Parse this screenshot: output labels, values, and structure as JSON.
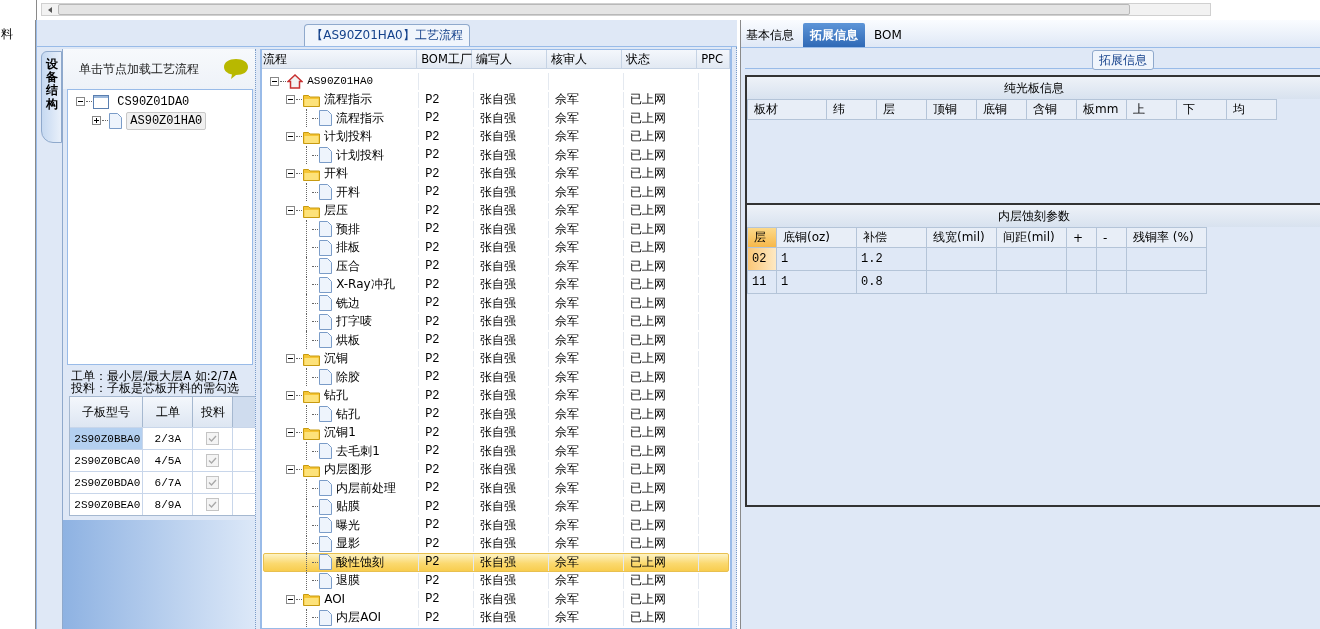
{
  "left_edge": {
    "label": "料"
  },
  "process_panel": {
    "title": "【AS90Z01HA0】工艺流程",
    "side_tab": "设备结构",
    "hint": "单击节点加载工艺流程",
    "device_tree": [
      {
        "name": "CS90Z01DA0",
        "expanded": true,
        "selected": false,
        "children": [
          {
            "name": "AS90Z01HA0",
            "expanded": false,
            "selected": true
          }
        ]
      }
    ],
    "notes": [
      "工单：最小层/最大层A 如:2/7A",
      "投料：子板是芯板开料的需勾选"
    ],
    "sub_boards": {
      "columns": [
        "子板型号",
        "工单",
        "投料"
      ],
      "rows": [
        {
          "model": "2S90Z0BBA0",
          "order": "2/3A",
          "feed": true,
          "selected": true
        },
        {
          "model": "2S90Z0BCA0",
          "order": "4/5A",
          "feed": true,
          "selected": false
        },
        {
          "model": "2S90Z0BDA0",
          "order": "6/7A",
          "feed": true,
          "selected": false
        },
        {
          "model": "2S90Z0BEA0",
          "order": "8/9A",
          "feed": true,
          "selected": false
        }
      ]
    }
  },
  "flow": {
    "columns": [
      "流程",
      "BOM工厂",
      "编写人",
      "核审人",
      "状态",
      "PPC"
    ],
    "root": {
      "kind": "product",
      "name": "AS90Z01HA0",
      "expanded": true,
      "selected": false,
      "children": [
        {
          "kind": "group",
          "name": "流程指示",
          "bom": "P2",
          "writer": "张自强",
          "reviewer": "佘军",
          "status": "已上网",
          "expanded": true,
          "selected": false,
          "children": [
            {
              "kind": "step",
              "name": "流程指示",
              "bom": "P2",
              "writer": "张自强",
              "reviewer": "佘军",
              "status": "已上网",
              "selected": false
            }
          ]
        },
        {
          "kind": "group",
          "name": "计划投料",
          "bom": "P2",
          "writer": "张自强",
          "reviewer": "佘军",
          "status": "已上网",
          "expanded": true,
          "selected": false,
          "children": [
            {
              "kind": "step",
              "name": "计划投料",
              "bom": "P2",
              "writer": "张自强",
              "reviewer": "佘军",
              "status": "已上网",
              "selected": false
            }
          ]
        },
        {
          "kind": "group",
          "name": "开料",
          "bom": "P2",
          "writer": "张自强",
          "reviewer": "佘军",
          "status": "已上网",
          "expanded": true,
          "selected": false,
          "children": [
            {
              "kind": "step",
              "name": "开料",
              "bom": "P2",
              "writer": "张自强",
              "reviewer": "佘军",
              "status": "已上网",
              "selected": false
            }
          ]
        },
        {
          "kind": "group",
          "name": "层压",
          "bom": "P2",
          "writer": "张自强",
          "reviewer": "佘军",
          "status": "已上网",
          "expanded": true,
          "selected": false,
          "children": [
            {
              "kind": "step",
              "name": "预排",
              "bom": "P2",
              "writer": "张自强",
              "reviewer": "佘军",
              "status": "已上网",
              "selected": false
            },
            {
              "kind": "step",
              "name": "排板",
              "bom": "P2",
              "writer": "张自强",
              "reviewer": "佘军",
              "status": "已上网",
              "selected": false
            },
            {
              "kind": "step",
              "name": "压合",
              "bom": "P2",
              "writer": "张自强",
              "reviewer": "佘军",
              "status": "已上网",
              "selected": false
            },
            {
              "kind": "step",
              "name": "X-Ray冲孔",
              "bom": "P2",
              "writer": "张自强",
              "reviewer": "佘军",
              "status": "已上网",
              "selected": false
            },
            {
              "kind": "step",
              "name": "铣边",
              "bom": "P2",
              "writer": "张自强",
              "reviewer": "佘军",
              "status": "已上网",
              "selected": false
            },
            {
              "kind": "step",
              "name": "打字唛",
              "bom": "P2",
              "writer": "张自强",
              "reviewer": "佘军",
              "status": "已上网",
              "selected": false
            },
            {
              "kind": "step",
              "name": "烘板",
              "bom": "P2",
              "writer": "张自强",
              "reviewer": "佘军",
              "status": "已上网",
              "selected": false
            }
          ]
        },
        {
          "kind": "group",
          "name": "沉铜",
          "bom": "P2",
          "writer": "张自强",
          "reviewer": "佘军",
          "status": "已上网",
          "expanded": true,
          "selected": false,
          "children": [
            {
              "kind": "step",
              "name": "除胶",
              "bom": "P2",
              "writer": "张自强",
              "reviewer": "佘军",
              "status": "已上网",
              "selected": false
            }
          ]
        },
        {
          "kind": "group",
          "name": "钻孔",
          "bom": "P2",
          "writer": "张自强",
          "reviewer": "佘军",
          "status": "已上网",
          "expanded": true,
          "selected": false,
          "children": [
            {
              "kind": "step",
              "name": "钻孔",
              "bom": "P2",
              "writer": "张自强",
              "reviewer": "佘军",
              "status": "已上网",
              "selected": false
            }
          ]
        },
        {
          "kind": "group",
          "name": "沉铜1",
          "bom": "P2",
          "writer": "张自强",
          "reviewer": "佘军",
          "status": "已上网",
          "expanded": true,
          "selected": false,
          "children": [
            {
              "kind": "step",
              "name": "去毛刺1",
              "bom": "P2",
              "writer": "张自强",
              "reviewer": "佘军",
              "status": "已上网",
              "selected": false
            }
          ]
        },
        {
          "kind": "group",
          "name": "内层图形",
          "bom": "P2",
          "writer": "张自强",
          "reviewer": "佘军",
          "status": "已上网",
          "expanded": true,
          "selected": false,
          "children": [
            {
              "kind": "step",
              "name": "内层前处理",
              "bom": "P2",
              "writer": "张自强",
              "reviewer": "佘军",
              "status": "已上网",
              "selected": false
            },
            {
              "kind": "step",
              "name": "贴膜",
              "bom": "P2",
              "writer": "张自强",
              "reviewer": "佘军",
              "status": "已上网",
              "selected": false
            },
            {
              "kind": "step",
              "name": "曝光",
              "bom": "P2",
              "writer": "张自强",
              "reviewer": "佘军",
              "status": "已上网",
              "selected": false
            },
            {
              "kind": "step",
              "name": "显影",
              "bom": "P2",
              "writer": "张自强",
              "reviewer": "佘军",
              "status": "已上网",
              "selected": false
            },
            {
              "kind": "step",
              "name": "酸性蚀刻",
              "bom": "P2",
              "writer": "张自强",
              "reviewer": "佘军",
              "status": "已上网",
              "selected": true
            },
            {
              "kind": "step",
              "name": "退膜",
              "bom": "P2",
              "writer": "张自强",
              "reviewer": "佘军",
              "status": "已上网",
              "selected": false
            }
          ]
        },
        {
          "kind": "group",
          "name": "AOI",
          "bom": "P2",
          "writer": "张自强",
          "reviewer": "佘军",
          "status": "已上网",
          "expanded": true,
          "selected": false,
          "children": [
            {
              "kind": "step",
              "name": "内层AOI",
              "bom": "P2",
              "writer": "张自强",
              "reviewer": "佘军",
              "status": "已上网",
              "selected": false
            }
          ]
        }
      ]
    }
  },
  "detail": {
    "tabs": [
      {
        "label": "基本信息",
        "selected": false
      },
      {
        "label": "拓展信息",
        "selected": true
      },
      {
        "label": "BOM",
        "selected": false
      }
    ],
    "group_title": "拓展信息",
    "bare_board": {
      "title": "纯光板信息",
      "columns": [
        "板材",
        "纬",
        "层",
        "顶铜",
        "底铜",
        "含铜",
        "板mm",
        "上",
        "下",
        "均"
      ]
    },
    "etch": {
      "title": "内层蚀刻参数",
      "columns": [
        "层",
        "底铜(oz)",
        "补偿",
        "线宽(mil)",
        "间距(mil)",
        "+",
        "-",
        "残铜率 (%)"
      ],
      "rows": [
        {
          "layer": "02",
          "base_copper": "1",
          "compensation": "1.2",
          "selected": true
        },
        {
          "layer": "11",
          "base_copper": "1",
          "compensation": "0.8",
          "selected": false
        }
      ]
    }
  }
}
